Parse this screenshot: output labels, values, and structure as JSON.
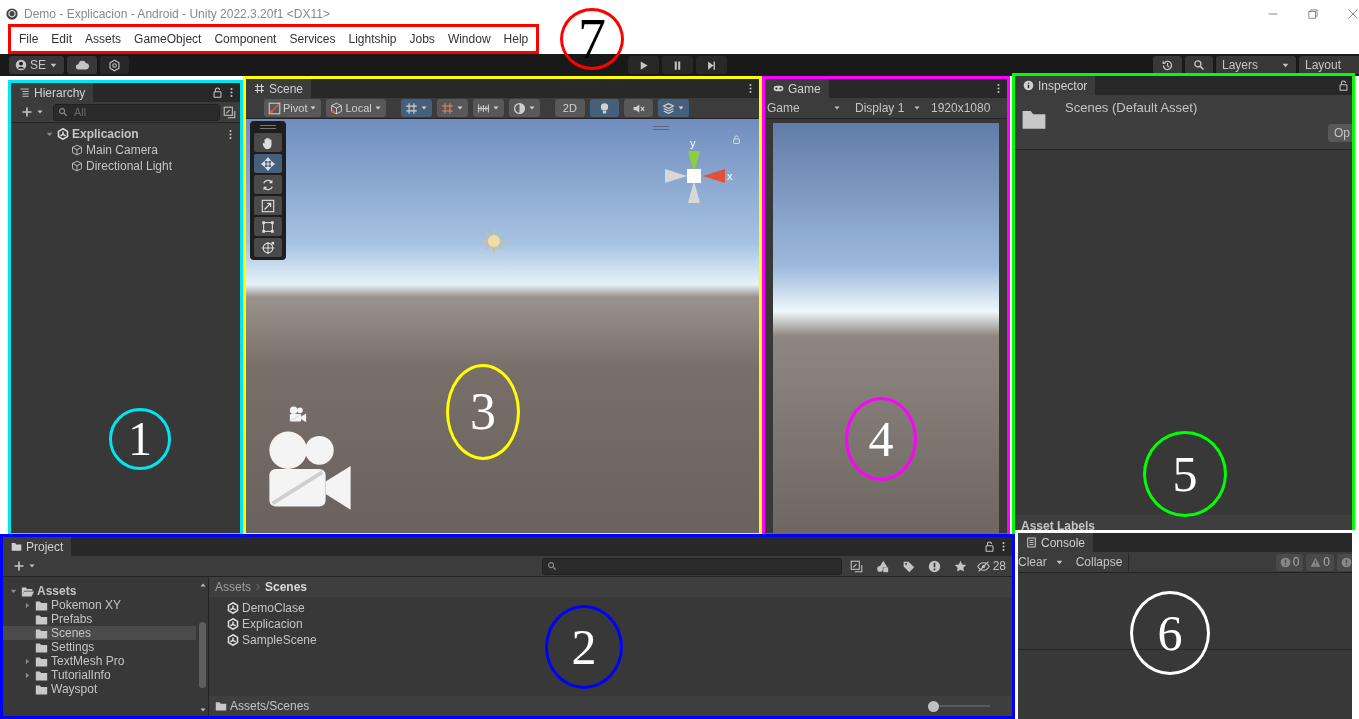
{
  "window": {
    "title": "Demo - Explicacion - Android - Unity 2022.3.20f1 <DX11>"
  },
  "menu": {
    "annotation": {
      "label": "7",
      "color": "#ff0000"
    },
    "items": [
      "File",
      "Edit",
      "Assets",
      "GameObject",
      "Component",
      "Services",
      "Lightship",
      "Jobs",
      "Window",
      "Help"
    ]
  },
  "toolbar": {
    "account": "SE",
    "layers": "Layers",
    "layout": "Layout"
  },
  "hierarchy": {
    "annotation": {
      "label": "1",
      "color": "#00e5ee"
    },
    "tab": "Hierarchy",
    "search_placeholder": "All",
    "tree": [
      {
        "label": "Explicacion",
        "kind": "scene",
        "expanded": true,
        "selected": false,
        "children": [
          {
            "label": "Main Camera",
            "kind": "object",
            "selected": false
          },
          {
            "label": "Directional Light",
            "kind": "object",
            "selected": false
          }
        ]
      }
    ]
  },
  "scene": {
    "annotation": {
      "label": "3",
      "color": "#ffff00"
    },
    "tab": "Scene",
    "toolbar": [
      {
        "kind": "pivot",
        "label": "Pivot",
        "active": false,
        "dropdown": true
      },
      {
        "kind": "local",
        "label": "Local",
        "active": false,
        "dropdown": true
      },
      {
        "kind": "grid",
        "active": true,
        "dropdown": true
      },
      {
        "kind": "snap",
        "active": false,
        "dropdown": true
      },
      {
        "kind": "ruler",
        "active": false,
        "dropdown": true
      },
      {
        "kind": "shading",
        "active": false,
        "dropdown": true
      },
      {
        "kind": "flat",
        "label": "2D",
        "active": false,
        "dropdown": false
      },
      {
        "kind": "light",
        "active": true,
        "dropdown": false
      },
      {
        "kind": "audio",
        "active": false,
        "dropdown": false
      },
      {
        "kind": "effects",
        "active": true,
        "dropdown": true
      }
    ],
    "tools": [
      {
        "kind": "hand",
        "selected": false
      },
      {
        "kind": "move",
        "selected": true
      },
      {
        "kind": "rotate",
        "selected": false
      },
      {
        "kind": "scale",
        "selected": false
      },
      {
        "kind": "rect",
        "selected": false
      },
      {
        "kind": "transform",
        "selected": false
      }
    ],
    "axes": [
      "y",
      "x"
    ]
  },
  "game": {
    "annotation": {
      "label": "4",
      "color": "#ff00ff"
    },
    "tab": "Game",
    "view": "Game",
    "display": "Display 1",
    "resolution": "1920x1080"
  },
  "inspector": {
    "annotation": {
      "label": "5",
      "color": "#00ff00"
    },
    "tab": "Inspector",
    "asset": "Scenes (Default Asset)",
    "open_button": "Op",
    "labels_header": "Asset Labels"
  },
  "project": {
    "annotation": {
      "label": "2",
      "color": "#0000ff"
    },
    "tab": "Project",
    "hidden_count": "28",
    "tree": [
      {
        "label": "Assets",
        "kind": "folder",
        "expanded": true,
        "selected": false,
        "children": [
          {
            "label": "Pokemon XY",
            "kind": "folder",
            "expanded": false,
            "selected": false
          },
          {
            "label": "Prefabs",
            "kind": "folder",
            "selected": false
          },
          {
            "label": "Scenes",
            "kind": "folder",
            "selected": true
          },
          {
            "label": "Settings",
            "kind": "folder",
            "selected": false
          },
          {
            "label": "TextMesh Pro",
            "kind": "folder",
            "expanded": false,
            "selected": false
          },
          {
            "label": "TutorialInfo",
            "kind": "folder",
            "expanded": false,
            "selected": false
          },
          {
            "label": "Wayspot",
            "kind": "folder",
            "selected": false
          }
        ]
      }
    ],
    "breadcrumb": [
      "Assets",
      "Scenes"
    ],
    "files": [
      "DemoClase",
      "Explicacion",
      "SampleScene"
    ],
    "path": "Assets/Scenes",
    "zoom": {
      "level": 0.0
    }
  },
  "console": {
    "annotation": {
      "label": "6",
      "color": "#ffffff"
    },
    "tab": "Console",
    "clear": "Clear",
    "collapse": "Collapse",
    "error_count": "0",
    "warning_count": "0"
  }
}
